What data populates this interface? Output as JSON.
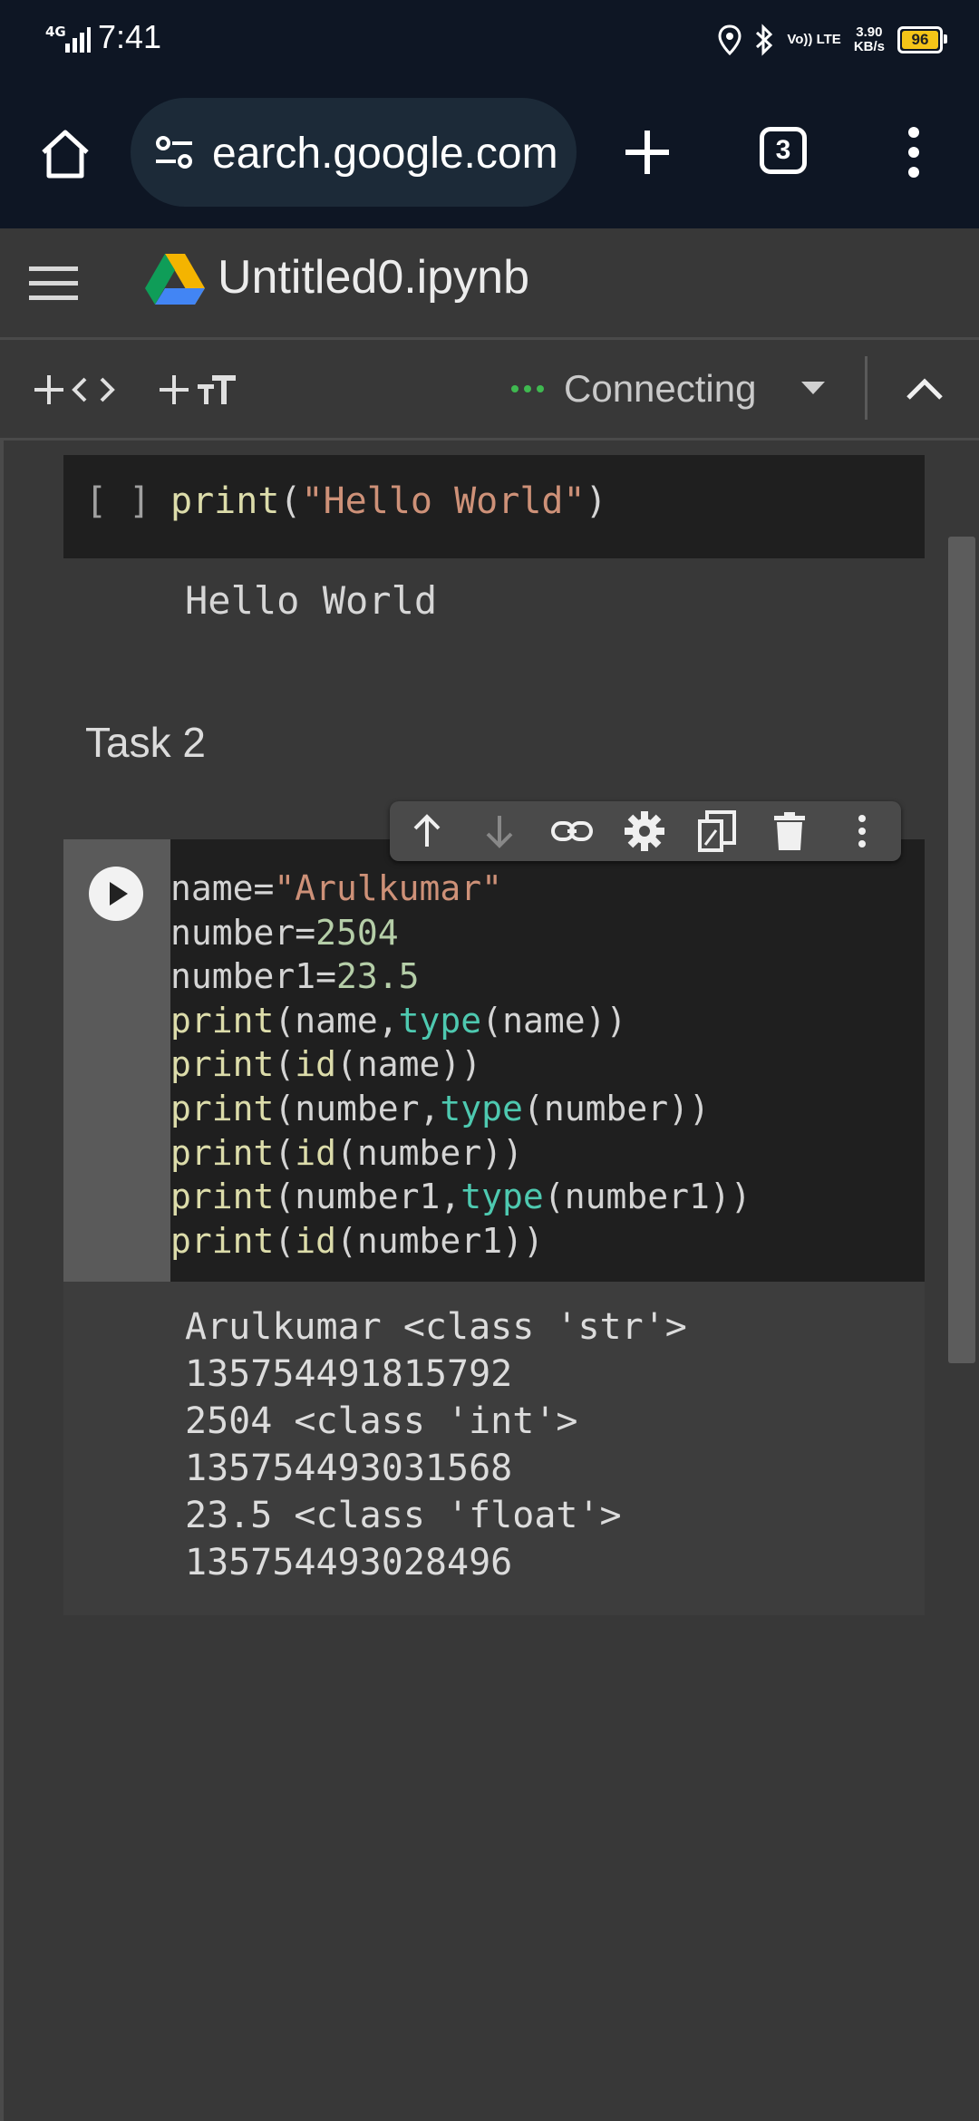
{
  "status_bar": {
    "network": "4G",
    "time": "7:41",
    "volte": "Vo)) LTE",
    "speed_value": "3.90",
    "speed_unit": "KB/s",
    "battery_level": "96"
  },
  "browser": {
    "url": "earch.google.com",
    "tab_count": "3"
  },
  "header": {
    "title": "Untitled0.ipynb"
  },
  "toolbar": {
    "connection_status": "Connecting"
  },
  "cell1": {
    "prompt": "[ ]",
    "code_fn": "print",
    "code_open": "(",
    "code_string": "\"Hello World\"",
    "code_close": ")",
    "output": "Hello World"
  },
  "heading": "Task 2",
  "cell2": {
    "lines": [
      [
        {
          "t": "name=",
          "c": "plain"
        },
        {
          "t": "\"Arulkumar\"",
          "c": "str"
        }
      ],
      [
        {
          "t": "number=",
          "c": "plain"
        },
        {
          "t": "2504",
          "c": "num"
        }
      ],
      [
        {
          "t": "number1=",
          "c": "plain"
        },
        {
          "t": "23.5",
          "c": "num"
        }
      ],
      [
        {
          "t": "print",
          "c": "kw"
        },
        {
          "t": "(name,",
          "c": "plain"
        },
        {
          "t": "type",
          "c": "bi"
        },
        {
          "t": "(name))",
          "c": "plain"
        }
      ],
      [
        {
          "t": "print",
          "c": "kw"
        },
        {
          "t": "(",
          "c": "plain"
        },
        {
          "t": "id",
          "c": "kw"
        },
        {
          "t": "(name))",
          "c": "plain"
        }
      ],
      [
        {
          "t": "print",
          "c": "kw"
        },
        {
          "t": "(number,",
          "c": "plain"
        },
        {
          "t": "type",
          "c": "bi"
        },
        {
          "t": "(number))",
          "c": "plain"
        }
      ],
      [
        {
          "t": "print",
          "c": "kw"
        },
        {
          "t": "(",
          "c": "plain"
        },
        {
          "t": "id",
          "c": "kw"
        },
        {
          "t": "(number))",
          "c": "plain"
        }
      ],
      [
        {
          "t": "print",
          "c": "kw"
        },
        {
          "t": "(number1,",
          "c": "plain"
        },
        {
          "t": "type",
          "c": "bi"
        },
        {
          "t": "(number1))",
          "c": "plain"
        }
      ],
      [
        {
          "t": "print",
          "c": "kw"
        },
        {
          "t": "(",
          "c": "plain"
        },
        {
          "t": "id",
          "c": "kw"
        },
        {
          "t": "(number1))",
          "c": "plain"
        }
      ]
    ],
    "output": [
      "Arulkumar <class 'str'>",
      "135754491815792",
      "2504 <class 'int'>",
      "135754493031568",
      "23.5 <class 'float'>",
      "135754493028496"
    ]
  },
  "cell_toolbar_icons": [
    "move-up-icon",
    "move-down-icon",
    "link-icon",
    "settings-icon",
    "mirror-cell-icon",
    "delete-icon",
    "more-vert-icon"
  ],
  "colors": {
    "status_bg": "#0e1624",
    "app_bg": "#383838",
    "code_bg": "#1f1f1f",
    "keyword": "#dcdcaa",
    "builtin": "#4ec9b0",
    "string": "#ce9178",
    "number": "#b5cea8",
    "connected_dots": "#3fb950",
    "battery": "#f5c518"
  }
}
